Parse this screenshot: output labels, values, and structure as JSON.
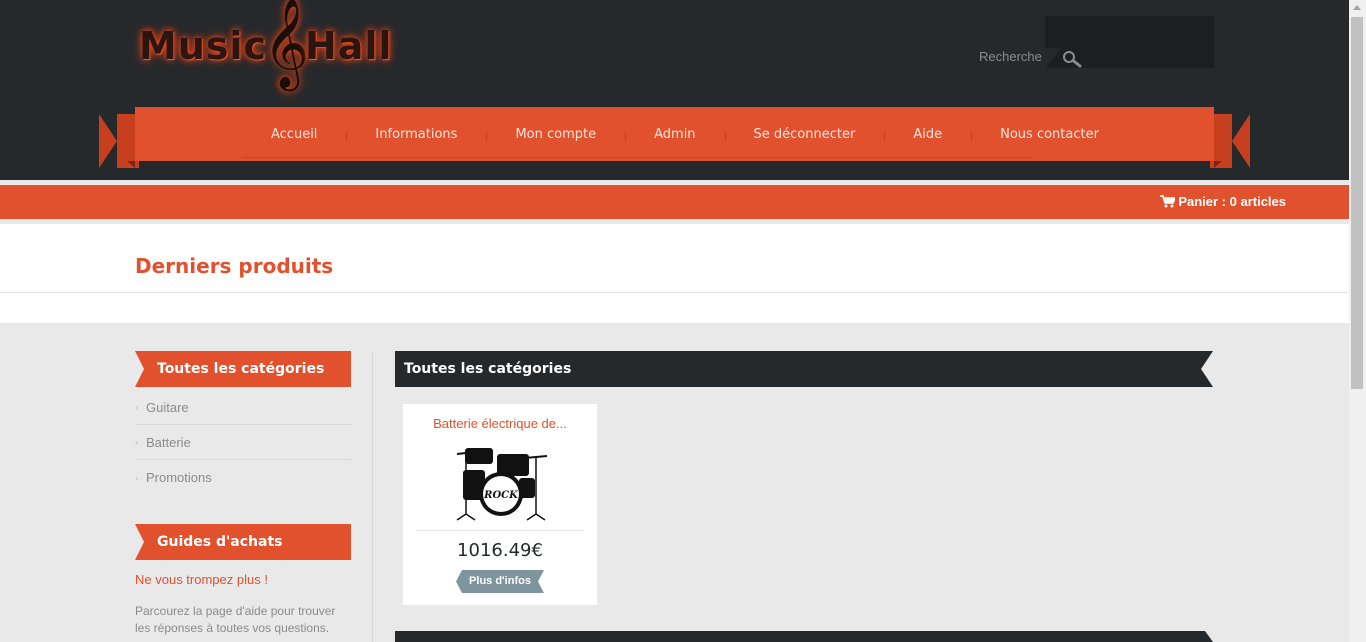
{
  "brand": {
    "left": "Music",
    "right": "Hall",
    "clef": "𝄞"
  },
  "search": {
    "label": "Recherche",
    "placeholder": ""
  },
  "nav": {
    "items": [
      {
        "label": "Accueil"
      },
      {
        "label": "Informations"
      },
      {
        "label": "Mon compte"
      },
      {
        "label": "Admin"
      },
      {
        "label": "Se déconnecter"
      },
      {
        "label": "Aide"
      },
      {
        "label": "Nous contacter"
      }
    ]
  },
  "cart": {
    "label": "Panier : 0 articles",
    "icon": "shopping-cart-icon"
  },
  "page_title": "Derniers produits",
  "sidebar": {
    "categories_title": "Toutes les catégories",
    "categories": [
      "Guitare",
      "Batterie",
      "Promotions"
    ],
    "guides_title": "Guides d'achats",
    "guides_link": "Ne vous trompez plus !",
    "guides_text": "Parcourez la page d'aide pour trouver les réponses à toutes vos questions."
  },
  "main": {
    "section_title": "Toutes les catégories",
    "products": [
      {
        "title": "Batterie électrique de...",
        "price": "1016.49€",
        "button": "Plus d'infos",
        "image_label": "ROCK"
      }
    ]
  },
  "colors": {
    "accent": "#e2512d",
    "dark": "#26292c",
    "button": "#7f959e"
  }
}
